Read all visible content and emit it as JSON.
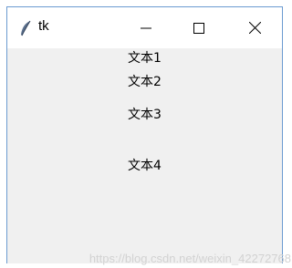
{
  "window": {
    "title": "tk",
    "app_icon": "feather-icon",
    "controls": {
      "minimize": "minimize-icon",
      "maximize": "maximize-icon",
      "close": "close-icon"
    }
  },
  "labels": [
    "文本1",
    "文本2",
    "文本3",
    "文本4"
  ],
  "watermark": "https://blog.csdn.net/weixin_42272768",
  "colors": {
    "titlebar_bg": "#ffffff",
    "client_bg": "#f0f0f0",
    "border": "#6b9bd1"
  }
}
